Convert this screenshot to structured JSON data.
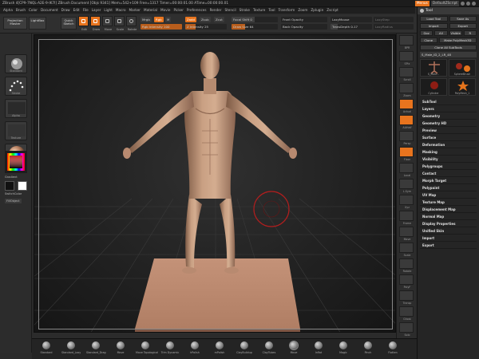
{
  "titlebar": {
    "title": "ZBrush 4[CP9-7NQL-A2E-9-IK7I]     ZBrush Document    [Objs 9341]  Mem=542+109  Free=1317  Timer=00:00:01.00  ATime=00:00:00.01",
    "menus": "Menus",
    "default_script": "DefaultZScript"
  },
  "menubar": [
    "Alpha",
    "Brush",
    "Color",
    "Document",
    "Draw",
    "Edit",
    "File",
    "Layer",
    "Light",
    "Macro",
    "Marker",
    "Material",
    "Movie",
    "Picker",
    "Preferences",
    "Render",
    "Stencil",
    "Stroke",
    "Texture",
    "Tool",
    "Transform",
    "Zoom",
    "Zplugin",
    "Zscript"
  ],
  "topshelf": {
    "projection_master": "Projection Master",
    "lightbox": "LightBox",
    "quick_sketch": "Quick Sketch",
    "edit": "Edit",
    "draw": "Draw",
    "move": "Move",
    "scale": "Scale",
    "rotate": "Rotate",
    "mrgb": "Mrgb",
    "rgb": "Rgb",
    "m": "M",
    "rgb_intensity": "Rgb Intensity 100",
    "zadd": "Zadd",
    "zsub": "Zsub",
    "zcut": "Zcut",
    "z_intensity": "Z Intensity 25",
    "focal_shift": "Focal Shift 0",
    "draw_size": "Draw Size 64",
    "front_opacity": "Front Opacity",
    "back_opacity": "Back Opacity",
    "lazymouse": "LazyMouse",
    "lazystep": "LazyStep",
    "lazyradius": "LazyRadius",
    "transpdepth": "TransDepth 0.17"
  },
  "leftshelf": {
    "thumbs": [
      "Standard",
      "Stroke",
      "Alpha",
      "Texture",
      "Material"
    ],
    "gradient": "Gradient",
    "switchcolor": "SwitchColor",
    "alternate": "FillObject"
  },
  "rightshelf": [
    "BPR",
    "SPix",
    "Scroll",
    "Zoom",
    "Actual",
    "AAHalf",
    "Persp",
    "Floor",
    "Local",
    "L.Sym",
    "Xyz",
    "Frame",
    "Move",
    "Scale",
    "Rotate",
    "PolyF",
    "Transp",
    "Ghost",
    "Solo",
    "Xpose"
  ],
  "toolpanel": {
    "title": "Tool",
    "row1": [
      "Load Tool",
      "Save As"
    ],
    "row2": [
      "Import",
      "Export"
    ],
    "row3": [
      "Goz",
      "All",
      "Visible",
      "R"
    ],
    "clone": "Clone",
    "make_polymesh": "Make PolyMesh3D",
    "clone_all": "Clone All SubTools",
    "slider": "S_Male_ID_2_LR_48",
    "cells": [
      "S_Male...",
      "SphereBrush",
      "Cylinder",
      "PolyMesh_1"
    ],
    "sections": [
      "SubTool",
      "Layers",
      "Geometry",
      "Geometry HD",
      "Preview",
      "Surface",
      "Deformation",
      "Masking",
      "Visibility",
      "Polygroups",
      "Contact",
      "Morph Target",
      "Polypaint",
      "UV Map",
      "Texture Map",
      "Displacement Map",
      "Normal Map",
      "Display Properties",
      "Unified Skin",
      "Import",
      "Export"
    ]
  },
  "bottomshelf": {
    "brushes": [
      "Standard",
      "Standard_Lazy",
      "Standard_Drag",
      "Move",
      "Move Topological",
      "Trim Dynamic",
      "hPolish",
      "mPolish",
      "ClayBuildup",
      "ClayTubes",
      "Move",
      "Inflat",
      "Magic",
      "Pinch",
      "Flatten"
    ],
    "selected_index": 10
  },
  "colors": {
    "accent": "#e8741e",
    "skin": "#c49a7e",
    "base": "#b8876a"
  }
}
